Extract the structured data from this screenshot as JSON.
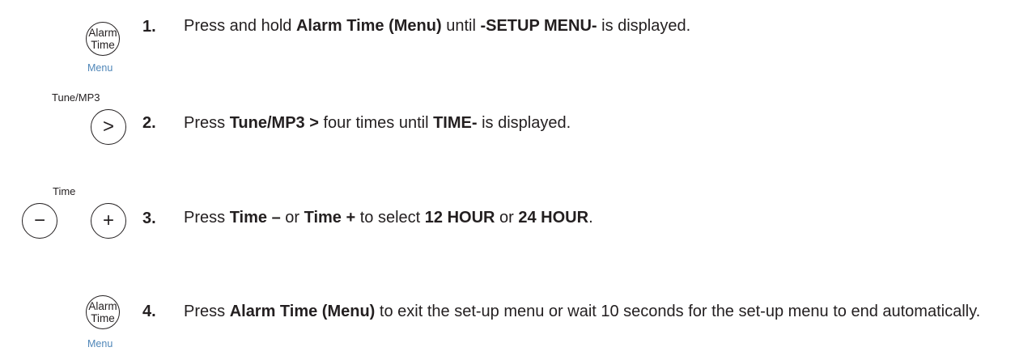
{
  "steps": [
    {
      "number": "1.",
      "parts": [
        "Press and hold ",
        "Alarm Time (Menu)",
        " until ",
        "-SETUP MENU-",
        " is displayed."
      ],
      "icon": {
        "label": "Alarm\nTime",
        "caption": "Menu"
      }
    },
    {
      "number": "2.",
      "parts": [
        "Press ",
        "Tune/MP3 >",
        " four times until ",
        "TIME-",
        " is displayed."
      ],
      "icon": {
        "label": ">",
        "caption": "Tune/MP3"
      }
    },
    {
      "number": "3.",
      "parts": [
        "Press ",
        "Time –",
        " or ",
        "Time +",
        " to select ",
        "12 HOUR",
        " or ",
        "24 HOUR",
        "."
      ],
      "icon": {
        "minus_label": "−",
        "plus_label": "+",
        "caption": "Time"
      }
    },
    {
      "number": "4.",
      "parts": [
        "Press ",
        "Alarm Time (Menu)",
        " to exit the set-up menu or wait 10 seconds for the set-up menu to end automatically."
      ],
      "icon": {
        "label": "Alarm\nTime",
        "caption": "Menu"
      }
    }
  ],
  "colors": {
    "text": "#231f20",
    "caption_blue": "#4f86b8"
  }
}
